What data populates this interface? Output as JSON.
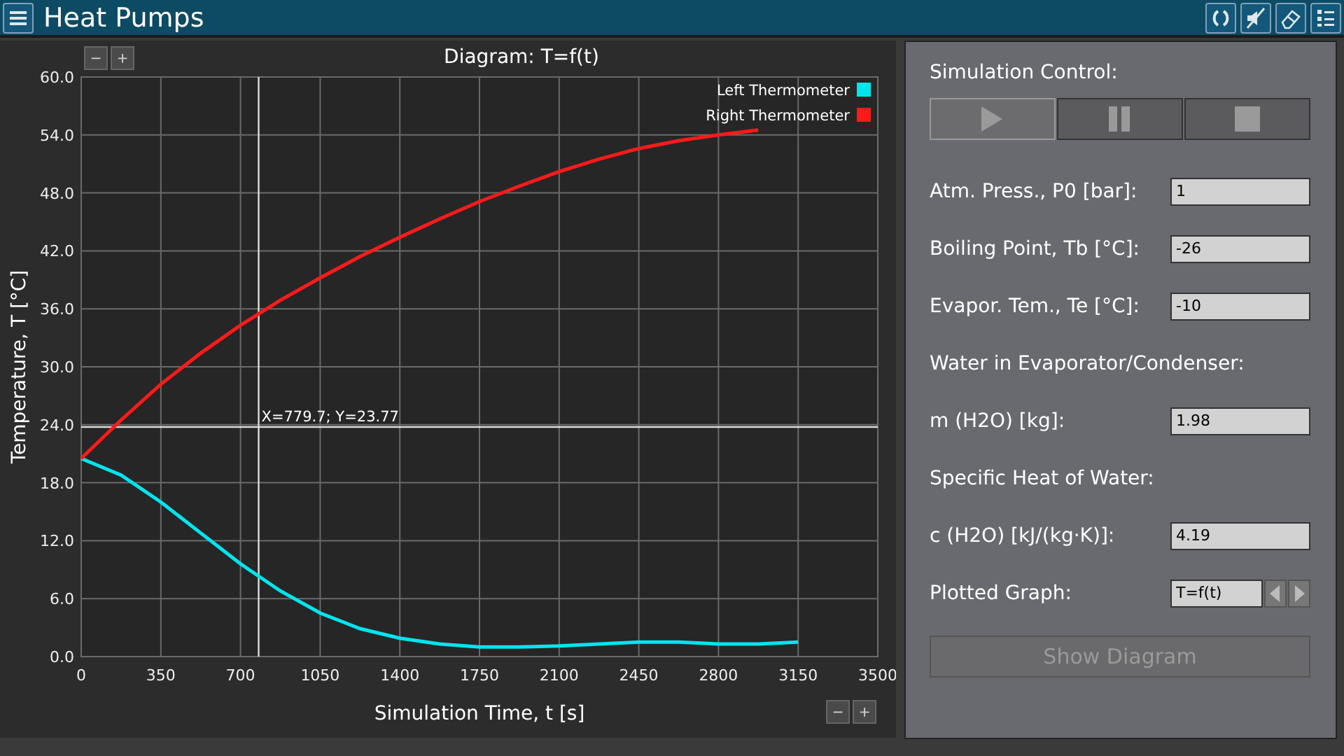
{
  "window": {
    "title": "Heat Pumps"
  },
  "diagram": {
    "zoom_top": [
      "−",
      "+"
    ],
    "zoom_bottom": [
      "−",
      "+"
    ],
    "chart_data": {
      "type": "line",
      "title": "Diagram: T=f(t)",
      "xlabel": "Simulation Time, t [s]",
      "ylabel": "Temperature, T [°C]",
      "x": [
        0,
        175,
        350,
        525,
        700,
        875,
        1050,
        1225,
        1400,
        1575,
        1750,
        1925,
        2100,
        2275,
        2450,
        2625,
        2800,
        2975,
        3150
      ],
      "series": [
        {
          "name": "Left Thermometer",
          "color": "#00e5ee",
          "values": [
            20.5,
            18.8,
            16.0,
            12.8,
            9.6,
            6.8,
            4.5,
            2.9,
            1.9,
            1.3,
            1.0,
            1.0,
            1.1,
            1.3,
            1.5,
            1.5,
            1.3,
            1.3,
            1.5
          ]
        },
        {
          "name": "Right Thermometer",
          "color": "#ff1a1a",
          "values": [
            20.5,
            24.5,
            28.2,
            31.4,
            34.3,
            36.9,
            39.2,
            41.4,
            43.4,
            45.3,
            47.1,
            48.7,
            50.2,
            51.5,
            52.6,
            53.4,
            54.0,
            54.5,
            null
          ]
        }
      ],
      "xlim": [
        0,
        3500
      ],
      "ylim": [
        0,
        60
      ],
      "xticks": [
        0,
        350,
        700,
        1050,
        1400,
        1750,
        2100,
        2450,
        2800,
        3150,
        3500
      ],
      "yticks": [
        {
          "value": 0,
          "label": "0.0"
        },
        {
          "value": 6,
          "label": "6.0"
        },
        {
          "value": 12,
          "label": "12.0"
        },
        {
          "value": 18,
          "label": "18.0"
        },
        {
          "value": 24,
          "label": "24.0"
        },
        {
          "value": 30,
          "label": "30.0"
        },
        {
          "value": 36,
          "label": "36.0"
        },
        {
          "value": 42,
          "label": "42.0"
        },
        {
          "value": 48,
          "label": "48.0"
        },
        {
          "value": 54,
          "label": "54.0"
        },
        {
          "value": 60,
          "label": "60.0"
        }
      ],
      "grid": true,
      "legend": "upper right",
      "ref_lines": [
        {
          "axis": "x",
          "value": 779.7
        },
        {
          "axis": "y",
          "value": 23.77
        }
      ],
      "annotations": [
        "X=779.7; Y=23.77"
      ]
    }
  },
  "control": {
    "title": "Simulation Control:",
    "playback": [
      {
        "kind": "play",
        "selected": true
      },
      {
        "kind": "pause",
        "selected": false
      },
      {
        "kind": "stop",
        "selected": false
      }
    ],
    "rows": [
      {
        "kind": "field",
        "label": "Atm. Press., P0 [bar]:",
        "value": "1"
      },
      {
        "kind": "field",
        "label": "Boiling Point, Tb [°C]:",
        "value": "-26"
      },
      {
        "kind": "field",
        "label": "Evapor. Tem., Te [°C]:",
        "value": "-10"
      },
      {
        "kind": "heading",
        "label": "Water in Evaporator/Condenser:"
      },
      {
        "kind": "field",
        "label": "m (H2O) [kg]:",
        "value": "1.98"
      },
      {
        "kind": "heading",
        "label": "Specific Heat of Water:"
      },
      {
        "kind": "field",
        "label": "c (H2O) [kJ/(kg·K)]:",
        "value": "4.19"
      },
      {
        "kind": "selector",
        "label": "Plotted Graph:",
        "value": "T=f(t)"
      }
    ],
    "action": {
      "label": "Show Diagram",
      "disabled": true
    }
  }
}
